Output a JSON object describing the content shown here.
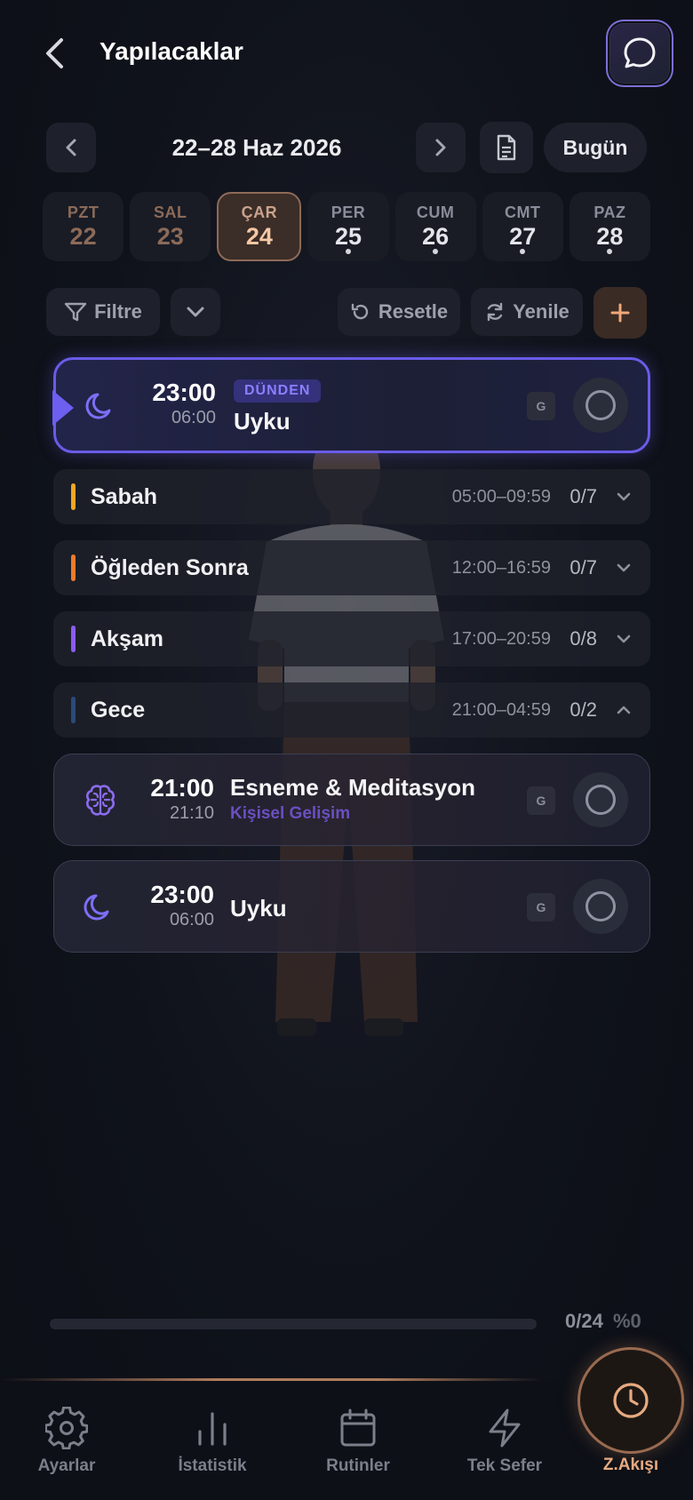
{
  "header": {
    "title": "Yapılacaklar"
  },
  "week": {
    "label": "22–28 Haz 2026",
    "today_label": "Bugün"
  },
  "days": [
    {
      "name": "PZT",
      "num": "22"
    },
    {
      "name": "SAL",
      "num": "23"
    },
    {
      "name": "ÇAR",
      "num": "24"
    },
    {
      "name": "PER",
      "num": "25"
    },
    {
      "name": "CUM",
      "num": "26"
    },
    {
      "name": "CMT",
      "num": "27"
    },
    {
      "name": "PAZ",
      "num": "28"
    }
  ],
  "toolbar": {
    "filter_label": "Filtre",
    "reset_label": "Resetle",
    "refresh_label": "Yenile"
  },
  "highlight_task": {
    "badge": "DÜNDEN",
    "start": "23:00",
    "end": "06:00",
    "title": "Uyku",
    "chip": "G",
    "icon": "moon-icon"
  },
  "sections": [
    {
      "name": "Sabah",
      "range": "05:00–09:59",
      "count": "0/7",
      "color": "#f5a524"
    },
    {
      "name": "Öğleden Sonra",
      "range": "12:00–16:59",
      "count": "0/7",
      "color": "#f07a2a"
    },
    {
      "name": "Akşam",
      "range": "17:00–20:59",
      "count": "0/8",
      "color": "#8b5cf6"
    },
    {
      "name": "Gece",
      "range": "21:00–04:59",
      "count": "0/2",
      "color": "#2b4a7a"
    }
  ],
  "night_tasks": [
    {
      "start": "21:00",
      "end": "21:10",
      "title": "Esneme & Meditasyon",
      "category": "Kişisel Gelişim",
      "chip": "G",
      "icon": "brain-icon"
    },
    {
      "start": "23:00",
      "end": "06:00",
      "title": "Uyku",
      "category": "",
      "chip": "G",
      "icon": "moon-icon"
    }
  ],
  "progress": {
    "count": "0/24",
    "percent": "%0",
    "fraction": 0
  },
  "bottom_nav": {
    "settings": "Ayarlar",
    "stats": "İstatistik",
    "routines": "Rutinler",
    "one_time": "Tek Sefer",
    "flow": "Z.Akışı"
  },
  "colors": {
    "accent": "#6a5ce8",
    "warm": "#c08660",
    "active_day": "#3b2d27"
  }
}
